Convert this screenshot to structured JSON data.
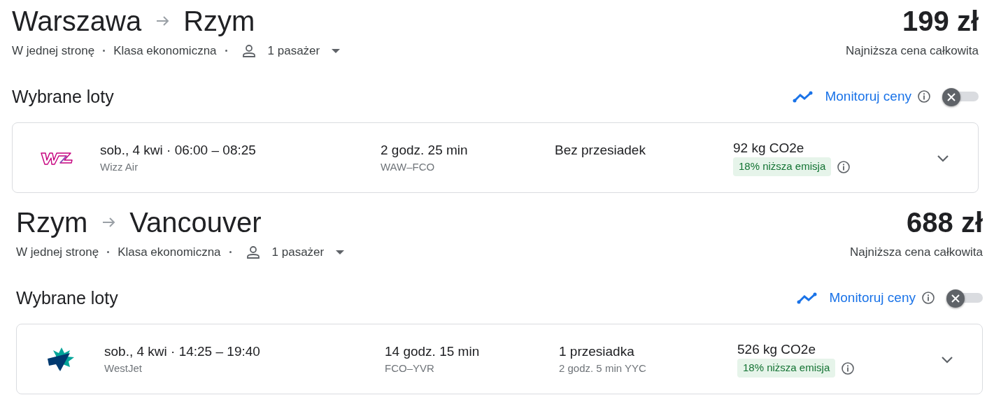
{
  "legs": [
    {
      "origin": "Warszawa",
      "destination": "Rzym",
      "price": "199 zł",
      "trip_type": "W jednej stronę",
      "cabin": "Klasa ekonomiczna",
      "passengers": "1 pasażer",
      "price_caption": "Najniższa cena całkowita",
      "section_title": "Wybrane loty",
      "monitor_label": "Monitoruj ceny",
      "monitor_on": false,
      "flight": {
        "kind": "wizz",
        "when": "sob., 4 kwi  ·  06:00 – 08:25",
        "airline": "Wizz Air",
        "duration": "2 godz. 25 min",
        "route": "WAW–FCO",
        "stops": "Bez przesiadek",
        "emissions": "92 kg CO2e",
        "emission_badge": "18% niższa emisja"
      }
    },
    {
      "origin": "Rzym",
      "destination": "Vancouver",
      "price": "688 zł",
      "trip_type": "W jednej stronę",
      "cabin": "Klasa ekonomiczna",
      "passengers": "1 pasażer",
      "price_caption": "Najniższa cena całkowita",
      "section_title": "Wybrane loty",
      "monitor_label": "Monitoruj ceny",
      "monitor_on": false,
      "flight": {
        "kind": "westjet",
        "when": "sob., 4 kwi  ·  14:25 – 19:40",
        "airline": "WestJet",
        "duration": "14 godz. 15 min",
        "route": "FCO–YVR",
        "stops": "1 przesiadka",
        "stops_detail": "2 godz. 5 min YYC",
        "emissions": "526 kg CO2e",
        "emission_badge": "18% niższa emisja"
      }
    }
  ]
}
